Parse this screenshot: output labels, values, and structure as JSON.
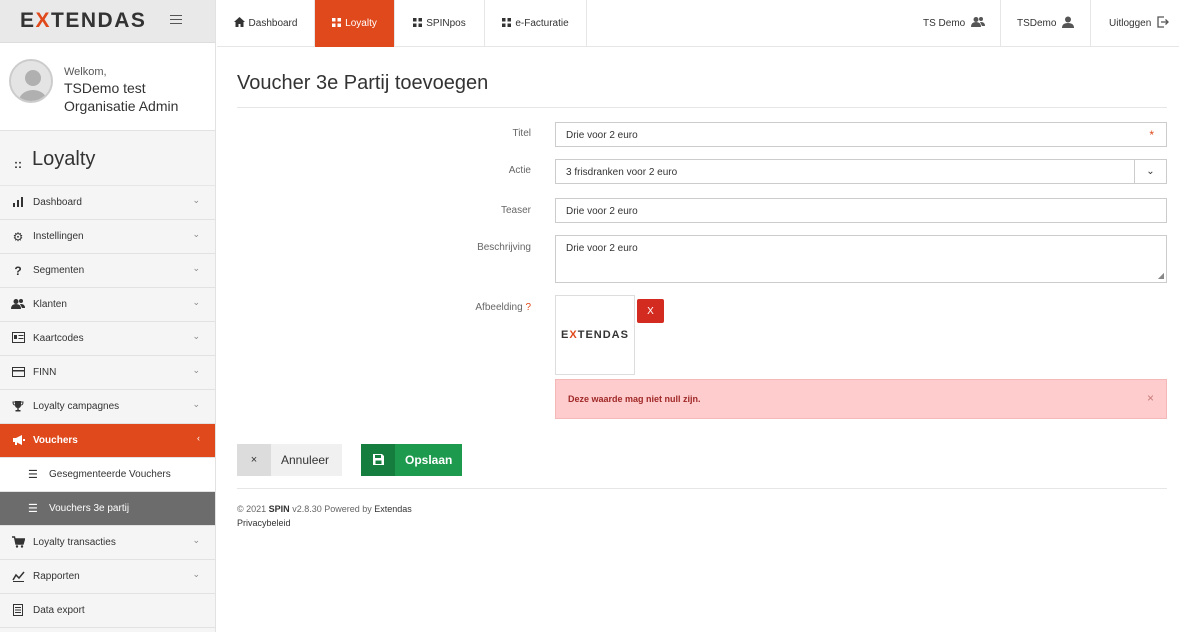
{
  "brand": {
    "logo_pre": "E",
    "logo_x": "X",
    "logo_post": "TENDAS",
    "accent": "#e0491b"
  },
  "welcome": {
    "greeting": "Welkom,",
    "name": "TSDemo test",
    "role": "Organisatie Admin"
  },
  "module": {
    "title": "Loyalty"
  },
  "sidebar": {
    "items": [
      {
        "label": "Dashboard",
        "icon": "bar-chart-icon"
      },
      {
        "label": "Instellingen",
        "icon": "gear-icon"
      },
      {
        "label": "Segmenten",
        "icon": "question-icon"
      },
      {
        "label": "Klanten",
        "icon": "users-icon"
      },
      {
        "label": "Kaartcodes",
        "icon": "id-card-icon"
      },
      {
        "label": "FINN",
        "icon": "credit-card-icon"
      },
      {
        "label": "Loyalty campagnes",
        "icon": "trophy-icon"
      },
      {
        "label": "Vouchers",
        "icon": "megaphone-icon"
      },
      {
        "label": "Loyalty transacties",
        "icon": "cart-icon"
      },
      {
        "label": "Rapporten",
        "icon": "line-chart-icon"
      },
      {
        "label": "Data export",
        "icon": "file-icon"
      }
    ],
    "sub": [
      {
        "label": "Gesegmenteerde Vouchers"
      },
      {
        "label": "Vouchers 3e partij"
      }
    ]
  },
  "topnav": {
    "tabs": [
      {
        "label": "Dashboard"
      },
      {
        "label": "Loyalty"
      },
      {
        "label": "SPINpos"
      },
      {
        "label": "e-Facturatie"
      }
    ],
    "org": "TS Demo",
    "user": "TSDemo",
    "logout": "Uitloggen"
  },
  "page": {
    "title": "Voucher 3e Partij toevoegen"
  },
  "form": {
    "titel": {
      "label": "Titel",
      "value": "Drie voor 2 euro",
      "required_mark": "*"
    },
    "actie": {
      "label": "Actie",
      "value": "3 frisdranken voor 2 euro"
    },
    "teaser": {
      "label": "Teaser",
      "value": "Drie voor 2 euro"
    },
    "beschrijving": {
      "label": "Beschrijving",
      "value": "Drie voor 2 euro"
    },
    "afbeelding": {
      "label": "Afbeelding",
      "help": "?",
      "delete": "X"
    }
  },
  "alert": {
    "text": "Deze waarde mag niet null zijn.",
    "close": "×"
  },
  "buttons": {
    "cancel": "Annuleer",
    "cancel_icon": "×",
    "save": "Opslaan"
  },
  "footer": {
    "copyright": "© 2021",
    "product": "SPIN",
    "version": "v2.8.30 Powered by",
    "powered": "Extendas",
    "privacy": "Privacybeleid"
  }
}
